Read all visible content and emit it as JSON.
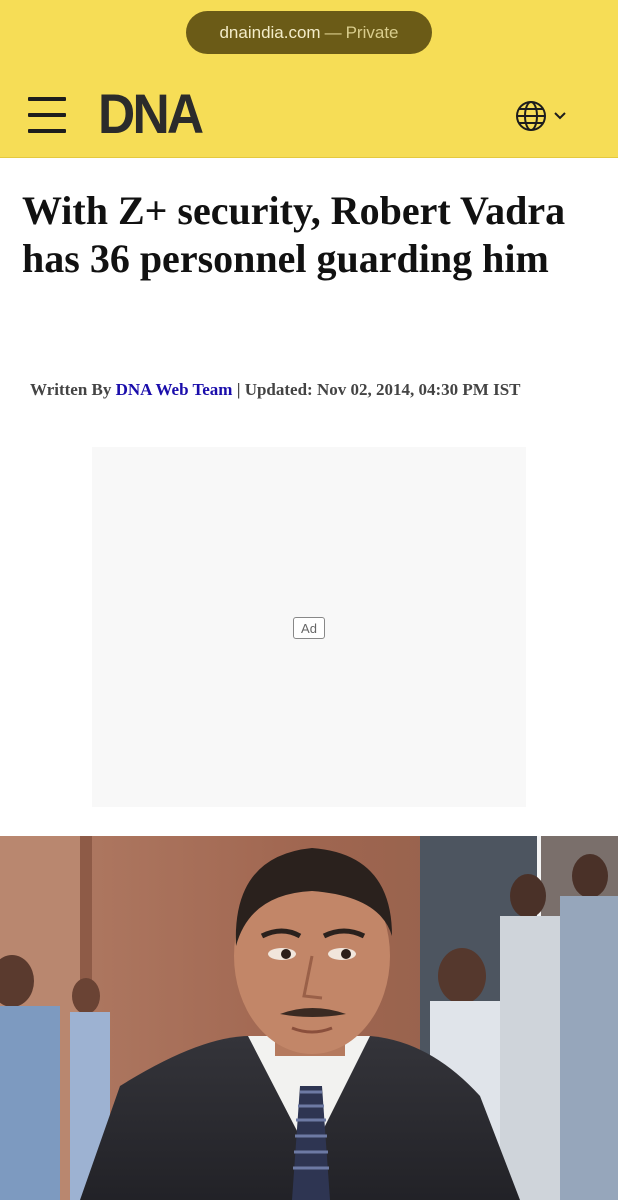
{
  "browser": {
    "domain": "dnaindia.com",
    "separator": "—",
    "mode": "Private"
  },
  "header": {
    "logo_text": "DNA",
    "background_color": "#f6dd56",
    "menu_icon": "hamburger-menu-icon",
    "language_icon": "globe-icon",
    "dropdown_icon": "chevron-down-icon"
  },
  "article": {
    "headline": "With Z+ security, Robert Vadra has 36 personnel guarding him",
    "byline_prefix": "Written By",
    "author": "DNA Web Team",
    "byline_separator": "|",
    "updated_label": "Updated:",
    "updated_date": "Nov 02, 2014, 04:30 PM IST",
    "author_color": "#1a0dab"
  },
  "ad": {
    "label": "Ad"
  },
  "photo": {
    "subject": "man in dark suit and striped tie"
  }
}
